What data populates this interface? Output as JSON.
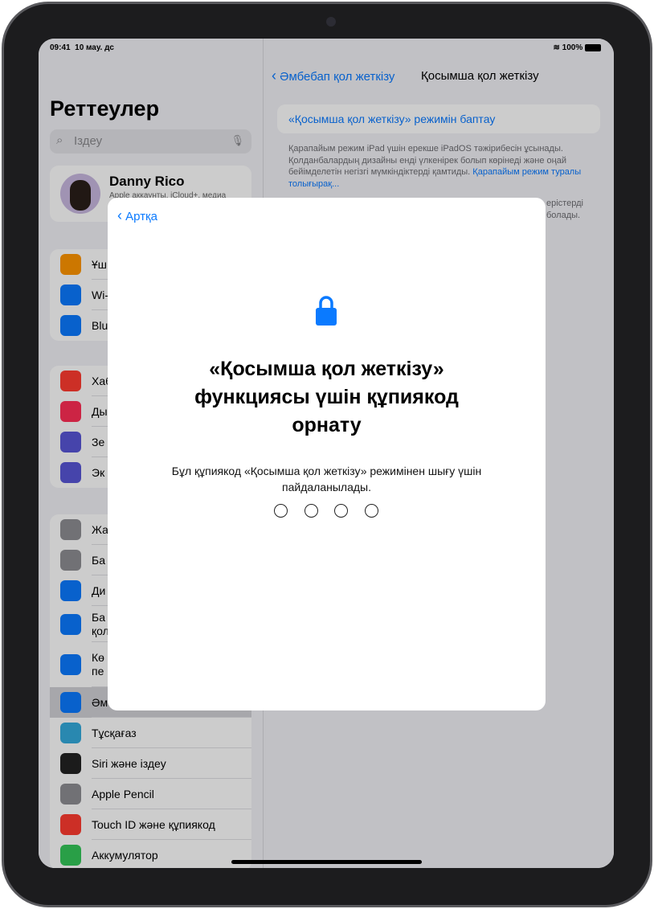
{
  "status_bar": {
    "time": "09:41",
    "date": "10 мау. дс",
    "battery": "100%"
  },
  "sidebar": {
    "title": "Реттеулер",
    "search_placeholder": "Іздеу",
    "profile": {
      "name": "Danny Rico",
      "subtitle": "Apple аккаунты, iCloud+, медиа"
    },
    "groups": [
      [
        {
          "label": "Ұш",
          "icon": "airplane-icon",
          "color": "#ff9500"
        },
        {
          "label": "Wi-",
          "icon": "wifi-icon",
          "color": "#0a7aff"
        },
        {
          "label": "Blu",
          "icon": "bluetooth-icon",
          "color": "#0a7aff"
        }
      ],
      [
        {
          "label": "Хаб",
          "icon": "notifications-icon",
          "color": "#ff3b30"
        },
        {
          "label": "Ды",
          "icon": "sound-icon",
          "color": "#ff2d55"
        },
        {
          "label": "Зе",
          "icon": "moon-icon",
          "color": "#5856d6"
        },
        {
          "label": "Эк",
          "icon": "hourglass-icon",
          "color": "#5856d6"
        }
      ],
      [
        {
          "label": "Жа",
          "icon": "gear-icon",
          "color": "#8e8e93"
        },
        {
          "label": "Ба",
          "icon": "control-center-icon",
          "color": "#8e8e93"
        },
        {
          "label": "Ди",
          "icon": "brightness-icon",
          "color": "#0a7aff"
        },
        {
          "label": "Ба",
          "label2": "қол",
          "icon": "home-screen-icon",
          "color": "#0a7aff"
        },
        {
          "label": "Кө",
          "label2": "пе",
          "icon": "multitasking-icon",
          "color": "#0a7aff"
        },
        {
          "label": "Әмбебап қол жеткізу",
          "icon": "accessibility-icon",
          "color": "#0a7aff",
          "selected": true
        },
        {
          "label": "Тұсқағаз",
          "icon": "wallpaper-icon",
          "color": "#34aadc"
        },
        {
          "label": "Siri және іздеу",
          "icon": "siri-icon",
          "color": "#222"
        },
        {
          "label": "Apple Pencil",
          "icon": "pencil-icon",
          "color": "#8e8e93"
        },
        {
          "label": "Touch ID және құпиякод",
          "icon": "lock-icon",
          "color": "#ff3b30"
        },
        {
          "label": "Аккумулятор",
          "icon": "battery-icon",
          "color": "#34c759"
        }
      ]
    ]
  },
  "detail": {
    "back_label": "Әмбебап қол жеткізу",
    "title": "Қосымша қол жеткізу",
    "setup_button": "«Қосымша қол жеткізу» режимін баптау",
    "footer": "Қарапайым режим iPad үшін ерекше iPadOS тәжірибесін ұсынады. Қолданбалардың дизайны енді үлкенірек болып көрінеді және оңай бейімделетін негізгі мүмкіндіктерді қамтиды.",
    "footer_link": "Қарапайым режим туралы толығырақ...",
    "partial_line1": "ерістерді",
    "partial_line2": "болады."
  },
  "modal": {
    "back_label": "Артқа",
    "icon": "lock-icon",
    "title": "«Қосымша қол жеткізу» функциясы үшін құпиякод орнату",
    "subtitle": "Бұл құпиякод «Қосымша қол жеткізу» режимінен шығу үшін пайдаланылады.",
    "passcode_length": 4,
    "entered_digits": 0
  },
  "accent_color": "#0a7aff"
}
